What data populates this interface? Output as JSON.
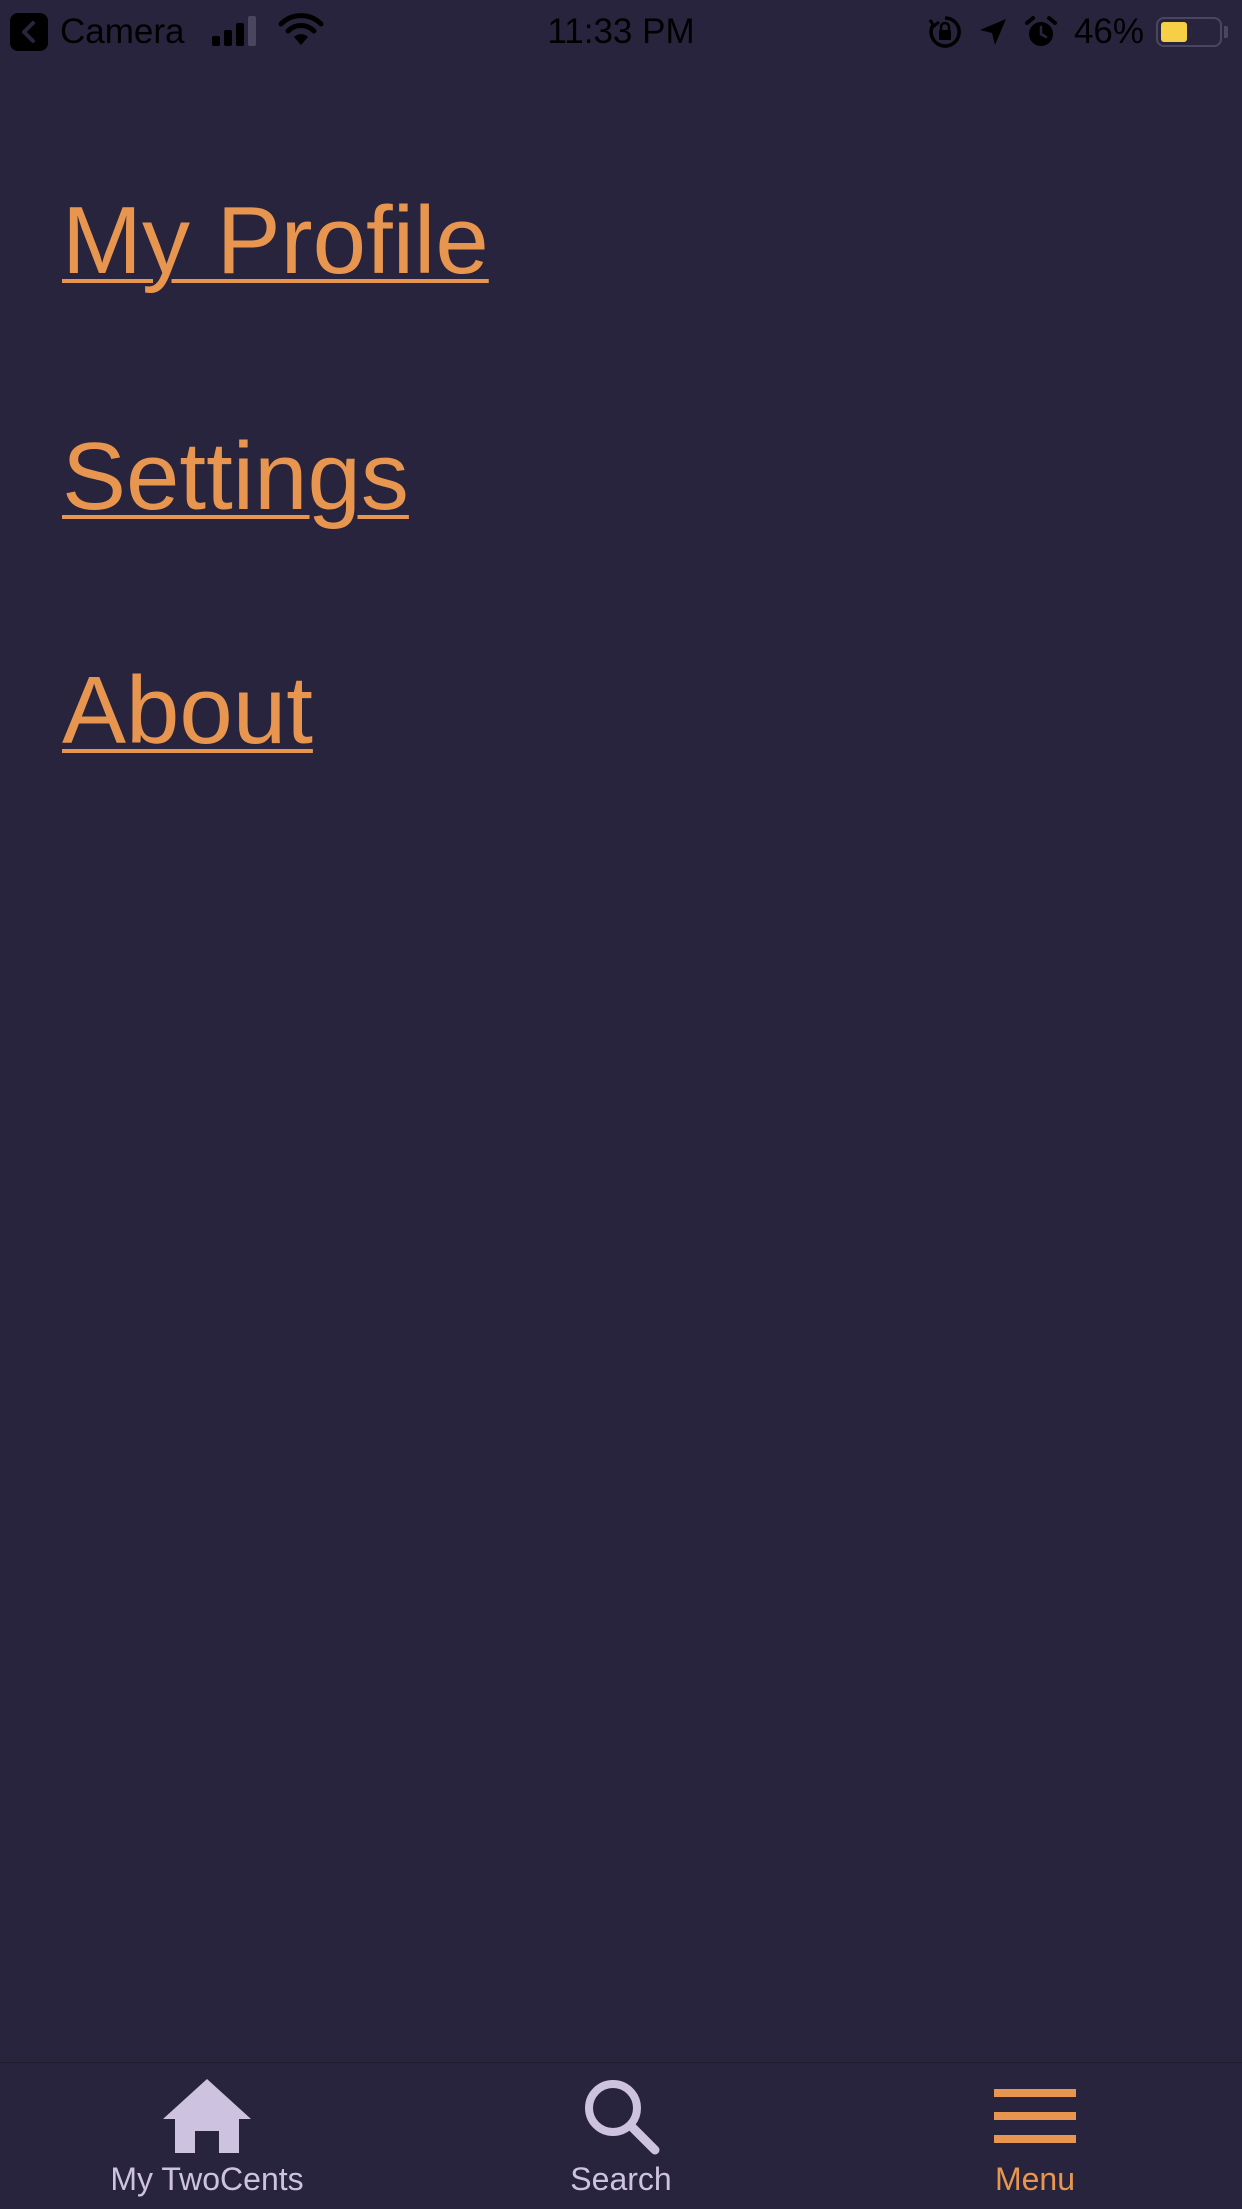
{
  "status_bar": {
    "back_app": "Camera",
    "time": "11:33 PM",
    "battery_percent": "46%",
    "battery_level": 0.46,
    "icons": [
      "back-chevron-icon",
      "cellular-signal-icon",
      "wifi-icon",
      "orientation-lock-icon",
      "location-arrow-icon",
      "alarm-icon",
      "battery-icon"
    ]
  },
  "menu": {
    "items": [
      {
        "label": "My Profile"
      },
      {
        "label": "Settings"
      },
      {
        "label": "About"
      }
    ]
  },
  "tab_bar": {
    "tabs": [
      {
        "label": "My TwoCents",
        "icon": "home-icon",
        "active": false
      },
      {
        "label": "Search",
        "icon": "search-icon",
        "active": false
      },
      {
        "label": "Menu",
        "icon": "hamburger-menu-icon",
        "active": true
      }
    ]
  },
  "colors": {
    "background": "#28243d",
    "accent": "#e8964f",
    "inactive": "#cdc3e1",
    "battery": "#f7cf46"
  }
}
